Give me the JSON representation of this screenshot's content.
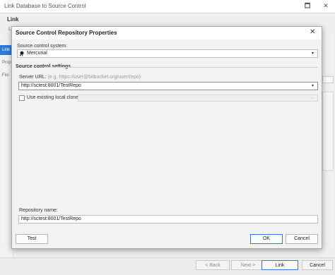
{
  "background_window": {
    "title": "Link Database to Source Control",
    "heading": "Link",
    "subtext": "L",
    "nav_items": [
      "Link",
      "Prop",
      "Fini"
    ],
    "footer_buttons": {
      "back": "< Back",
      "next": "Next >",
      "link": "Link",
      "cancel": "Cancel"
    },
    "window_controls": {
      "minimize": "🗖",
      "close": "✕"
    }
  },
  "dialog": {
    "title": "Source Control Repository Properties",
    "close_glyph": "✕",
    "source_control_system": {
      "label": "Source control system:",
      "value": "Mercurial",
      "icon": "mercurial-icon",
      "arrow": "▾"
    },
    "settings": {
      "heading": "Source control settings",
      "server_url_label": "Server URL:",
      "server_url_hint": "(e.g. https://user@bitbucket.org/user/repo)",
      "server_url_value": "http://sctest:8001/TestRepo",
      "server_url_arrow": "▾",
      "use_existing_label": "Use existing local clone",
      "use_existing_checked": false,
      "browse_glyph": "..."
    },
    "repository_name": {
      "label": "Repository name:",
      "value": "http://sctest:8001/TestRepo"
    },
    "buttons": {
      "test": "Test",
      "ok": "OK",
      "cancel": "Cancel"
    }
  },
  "colors": {
    "accent": "#2f7bd9",
    "dialog_background": "#f2f2f2",
    "footer_background": "#ececec"
  }
}
